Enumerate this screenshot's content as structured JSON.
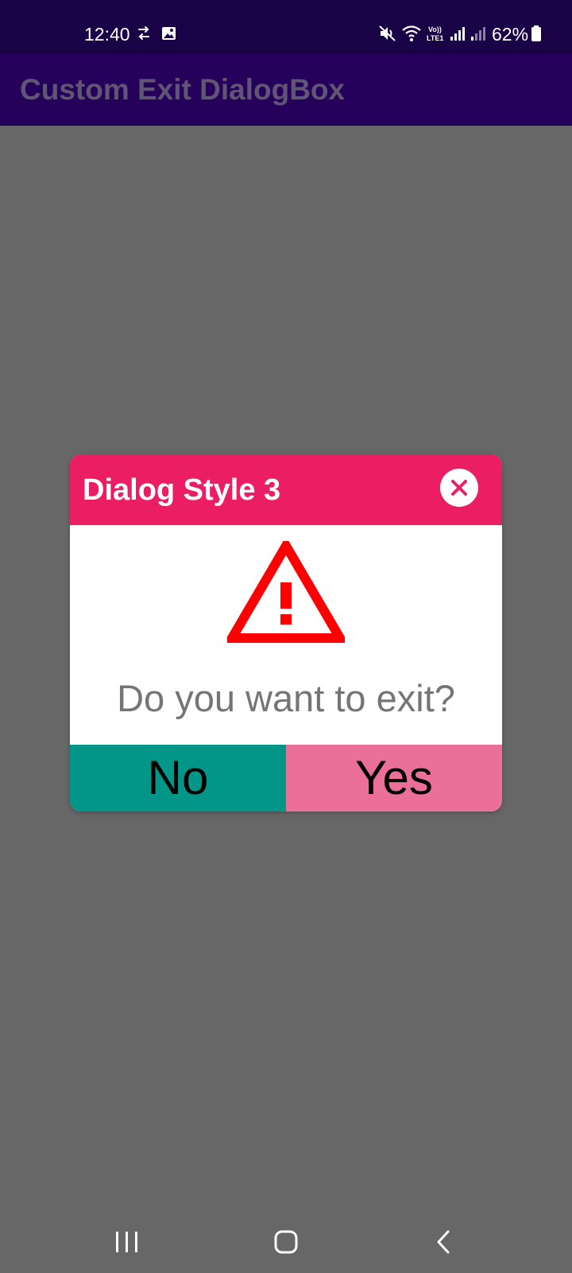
{
  "status_bar": {
    "time": "12:40",
    "battery_percent": "62%",
    "icons": [
      "sync-icon",
      "gallery-icon",
      "mute-icon",
      "wifi-icon",
      "volte-icon",
      "signal-icon",
      "signal-weak-icon",
      "battery-icon"
    ]
  },
  "app_bar": {
    "title": "Custom Exit DialogBox"
  },
  "dialog": {
    "title": "Dialog Style 3",
    "message": "Do you want to exit?",
    "no_label": "No",
    "yes_label": "Yes",
    "colors": {
      "header": "#eb1e63",
      "no_button": "#019688",
      "yes_button": "#eb7099",
      "warning": "#ff0000"
    }
  },
  "nav_bar": {
    "buttons": [
      "recent-apps-icon",
      "home-icon",
      "back-icon"
    ]
  }
}
